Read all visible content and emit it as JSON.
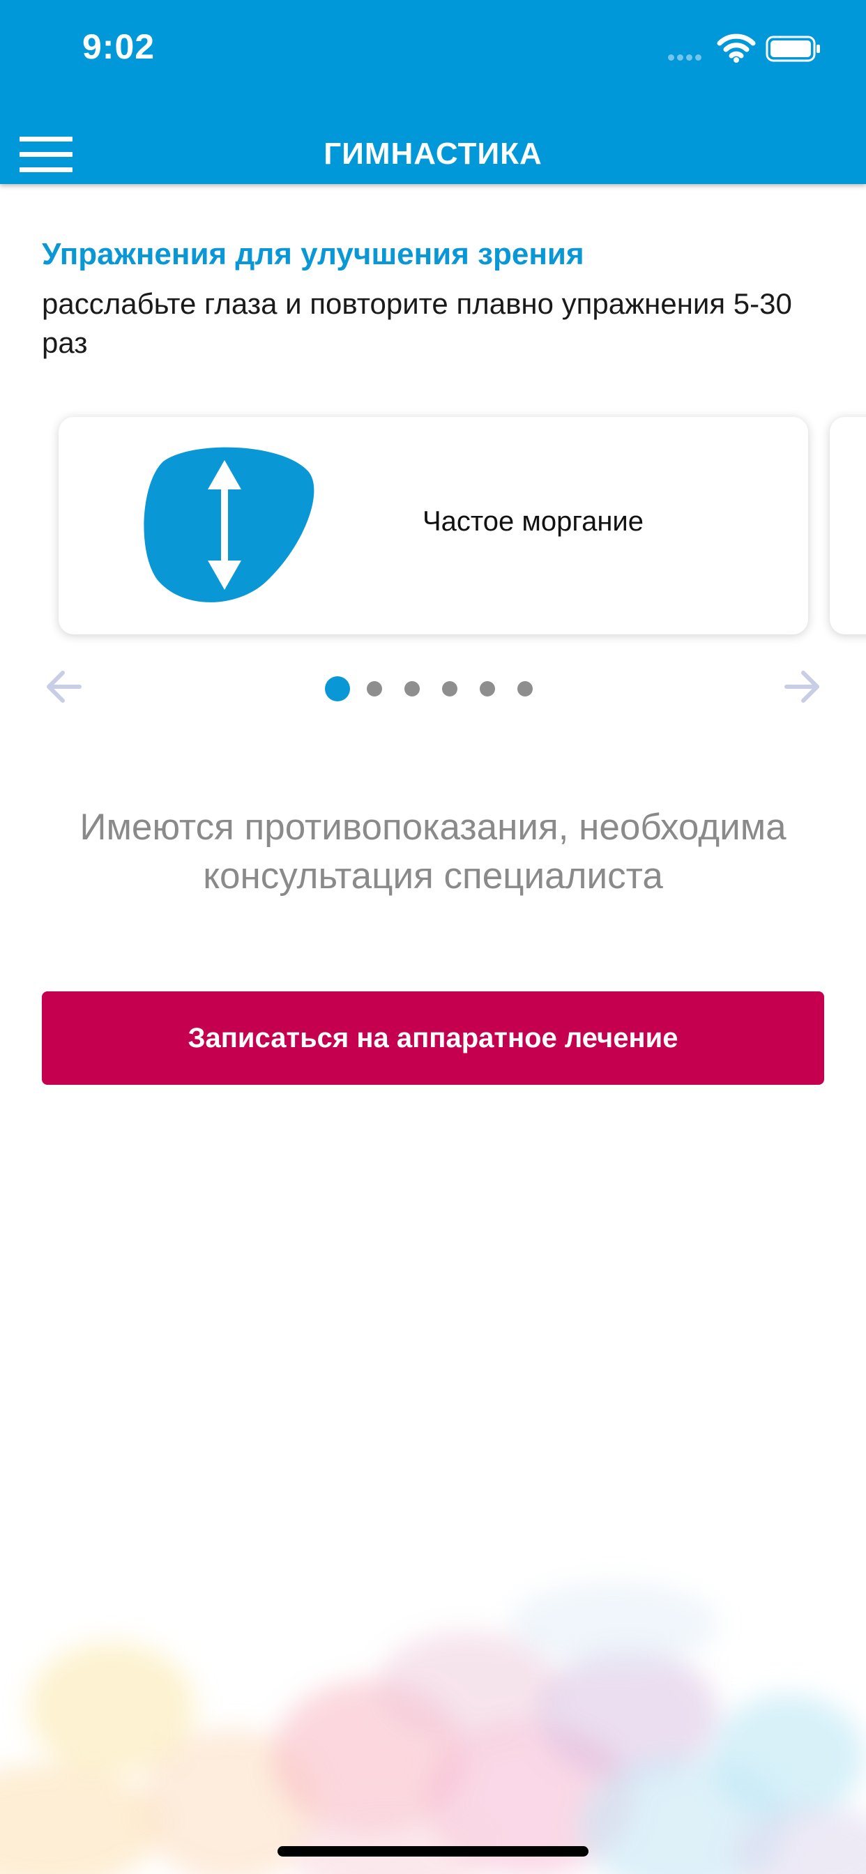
{
  "status_bar": {
    "time": "9:02",
    "icons": [
      "signal-icon",
      "wifi-icon",
      "battery-icon"
    ]
  },
  "header": {
    "title": "ГИМНАСТИКА",
    "menu_icon": "hamburger-menu-icon",
    "background_color": "#0098d8"
  },
  "intro": {
    "title": "Упражнения для улучшения зрения",
    "subtitle": "расслабьте глаза и повторите плавно упражнения 5-30 раз"
  },
  "carousel": {
    "cards": [
      {
        "label": "Частое моргание",
        "icon": "vertical-arrows-icon"
      }
    ],
    "page_count": 6,
    "active_page": 1,
    "prev_icon": "arrow-left-icon",
    "next_icon": "arrow-right-icon"
  },
  "warning": {
    "text": "Имеются противопоказания, необходима консультация специалиста"
  },
  "cta": {
    "label": "Записаться на аппаратное лечение",
    "color": "#c4004f"
  },
  "colors": {
    "accent": "#0a97d6",
    "primary_button": "#c4004f"
  }
}
